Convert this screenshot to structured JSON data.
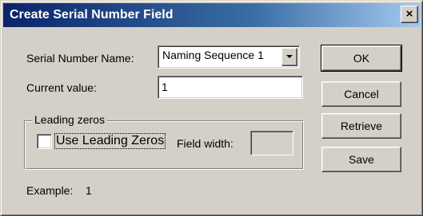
{
  "window": {
    "title": "Create Serial Number Field",
    "close_label": "×"
  },
  "form": {
    "serial_number_name_label": "Serial Number Name:",
    "serial_number_name_value": "Naming Sequence 1",
    "current_value_label": "Current value:",
    "current_value": "1",
    "leading_zeros": {
      "group_title": "Leading zeros",
      "checkbox_label": "Use Leading Zeros",
      "checked": false,
      "field_width_label": "Field width:",
      "field_width_value": ""
    },
    "example_label": "Example:",
    "example_value": "1"
  },
  "buttons": {
    "ok": "OK",
    "cancel": "Cancel",
    "retrieve": "Retrieve",
    "save": "Save"
  }
}
